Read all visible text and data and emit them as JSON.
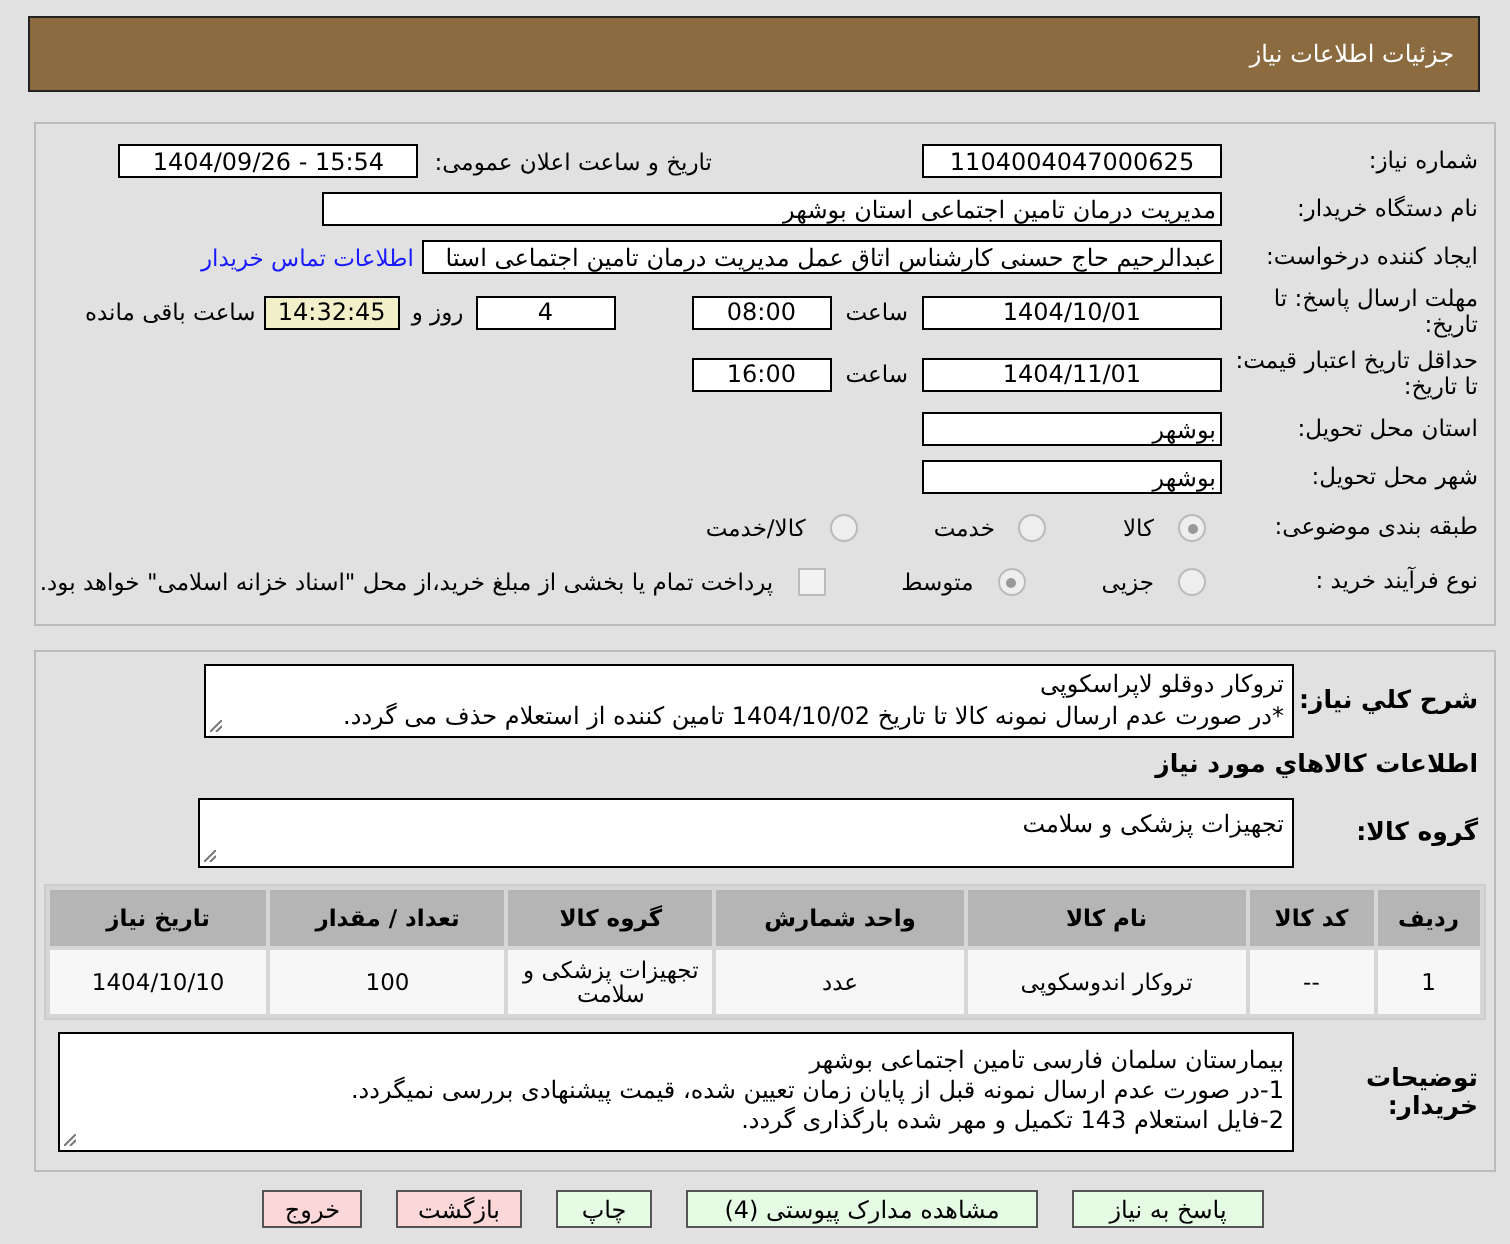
{
  "header": {
    "title": "جزئیات اطلاعات نیاز"
  },
  "need_number": {
    "label": "شماره نیاز:",
    "value": "1104004047000625"
  },
  "announce": {
    "label": "تاریخ و ساعت اعلان عمومی:",
    "value": "1404/09/26 - 15:54"
  },
  "buyer_org": {
    "label": "نام دستگاه خریدار:",
    "value": "مدیریت درمان تامین اجتماعی استان بوشهر"
  },
  "requester": {
    "label": "ایجاد کننده درخواست:",
    "value": "عبدالرحیم حاج حسنی کارشناس اتاق عمل مدیریت درمان تامین اجتماعی استا",
    "contact_link": "اطلاعات تماس خریدار"
  },
  "deadline": {
    "label": "مهلت ارسال پاسخ: تا تاریخ:",
    "date": "1404/10/01",
    "time_label": "ساعت",
    "time": "08:00",
    "days": "4",
    "days_label": "روز و",
    "remaining": "14:32:45",
    "remaining_label": "ساعت باقی مانده"
  },
  "validity": {
    "label": "حداقل تاریخ اعتبار قیمت: تا تاریخ:",
    "date": "1404/11/01",
    "time_label": "ساعت",
    "time": "16:00"
  },
  "province": {
    "label": "استان محل تحویل:",
    "value": "بوشهر"
  },
  "city": {
    "label": "شهر محل تحویل:",
    "value": "بوشهر"
  },
  "category": {
    "label": "طبقه بندی موضوعی:",
    "options": [
      {
        "label": "کالا",
        "selected": true
      },
      {
        "label": "خدمت",
        "selected": false
      },
      {
        "label": "کالا/خدمت",
        "selected": false
      }
    ]
  },
  "purchase_type": {
    "label": "نوع فرآیند خرید :",
    "options": [
      {
        "label": "جزیی",
        "selected": false
      },
      {
        "label": "متوسط",
        "selected": true
      }
    ],
    "payment": {
      "checked": false,
      "text": "پرداخت تمام یا بخشی از مبلغ خرید،از محل \"اسناد خزانه اسلامی\" خواهد بود."
    }
  },
  "summary": {
    "label": "شرح کلي نياز:",
    "lines": [
      "تروکار دوقلو لاپراسکوپی",
      "*در صورت عدم ارسال نمونه کالا تا تاریخ 1404/10/02 تامین کننده از استعلام حذف می گردد."
    ]
  },
  "goods_title": "اطلاعات کالاهاي مورد نياز",
  "goods_group": {
    "label": "گروه کالا:",
    "value": "تجهیزات پزشکی و سلامت"
  },
  "table": {
    "columns": [
      "ردیف",
      "کد کالا",
      "نام کالا",
      "واحد شمارش",
      "گروه کالا",
      "تعداد / مقدار",
      "تاریخ نیاز"
    ],
    "rows": [
      [
        "1",
        "--",
        "تروکار اندوسکوپی",
        "عدد",
        "تجهیزات پزشکی و سلامت",
        "100",
        "1404/10/10"
      ]
    ]
  },
  "buyer_notes": {
    "label": "توضیحات خریدار:",
    "lines": [
      "بیمارستان سلمان فارسی تامین اجتماعی  بوشهر",
      "1-در صورت عدم ارسال نمونه قبل از پایان زمان تعیین شده، قیمت پیشنهادی بررسی نمیگردد.",
      "2-فایل استعلام 143 تکمیل و مهر شده بارگذاری گردد."
    ]
  },
  "buttons": [
    {
      "label": "پاسخ به نیاز",
      "kind": "normal"
    },
    {
      "label": "مشاهده مدارک پیوستی (4)",
      "kind": "normal"
    },
    {
      "label": "چاپ",
      "kind": "normal"
    },
    {
      "label": "بازگشت",
      "kind": "danger"
    },
    {
      "label": "خروج",
      "kind": "danger"
    }
  ]
}
